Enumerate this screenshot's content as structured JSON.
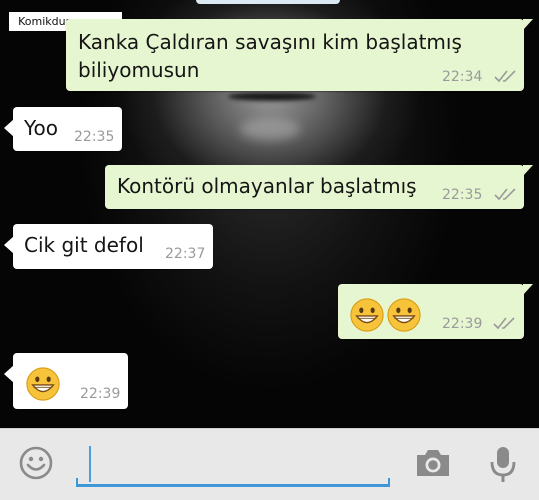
{
  "watermark": "Komikdunya.com",
  "messages": [
    {
      "direction": "out",
      "text": "Kanka Çaldıran savaşını kim başlatmış",
      "text2": "biliyomusun",
      "time": "22:34",
      "status": "read"
    },
    {
      "direction": "in",
      "text": "Yoo",
      "time": "22:35"
    },
    {
      "direction": "out",
      "text": "Kontörü olmayanlar başlatmış",
      "time": "22:35",
      "status": "read"
    },
    {
      "direction": "in",
      "text": "Cik git defol",
      "time": "22:37"
    },
    {
      "direction": "out",
      "emoji": [
        "grinning-face-emoji",
        "grinning-face-emoji"
      ],
      "time": "22:39",
      "status": "read"
    },
    {
      "direction": "in",
      "emoji": [
        "grinning-face-emoji"
      ],
      "time": "22:39"
    }
  ],
  "input_bar": {
    "text": "",
    "icons": [
      "smiley-icon",
      "camera-icon",
      "microphone-icon"
    ]
  },
  "colors": {
    "outgoing_bubble": "#e6f6d0",
    "incoming_bubble": "#ffffff",
    "input_underline": "#3e98d8",
    "input_bar_bg": "#e8e8e8"
  }
}
